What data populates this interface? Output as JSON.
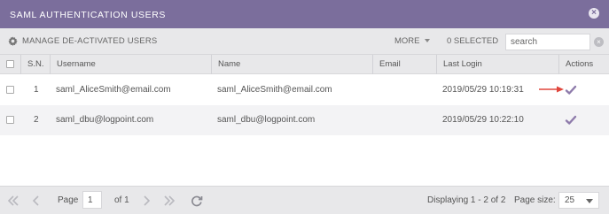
{
  "dialog": {
    "title": "SAML AUTHENTICATION USERS",
    "close_icon": "close-icon"
  },
  "toolbar": {
    "manage_label": "MANAGE DE-ACTIVATED USERS",
    "manage_icon": "gear-icon",
    "more_label": "MORE",
    "selected_label": "0 SELECTED",
    "search_placeholder": "search",
    "search_value": ""
  },
  "table": {
    "columns": [
      "S.N.",
      "Username",
      "Name",
      "Email",
      "Last Login",
      "Actions"
    ],
    "rows": [
      {
        "sn": "1",
        "username": "saml_AliceSmith@email.com",
        "name": "saml_AliceSmith@email.com",
        "email": "",
        "last_login": "2019/05/29 10:19:31",
        "action_icon": "check-icon"
      },
      {
        "sn": "2",
        "username": "saml_dbu@logpoint.com",
        "name": "saml_dbu@logpoint.com",
        "email": "",
        "last_login": "2019/05/29 10:22:10",
        "action_icon": "check-icon"
      }
    ]
  },
  "pagination": {
    "page_label": "Page",
    "page_value": "1",
    "of_label": "of 1",
    "displaying": "Displaying 1 - 2 of 2",
    "page_size_label": "Page size:",
    "page_size_value": "25"
  },
  "colors": {
    "titlebar": "#7b6e9c",
    "toolbar": "#e8e8ea",
    "check": "#8e7bab",
    "arrow": "#e0463c"
  }
}
